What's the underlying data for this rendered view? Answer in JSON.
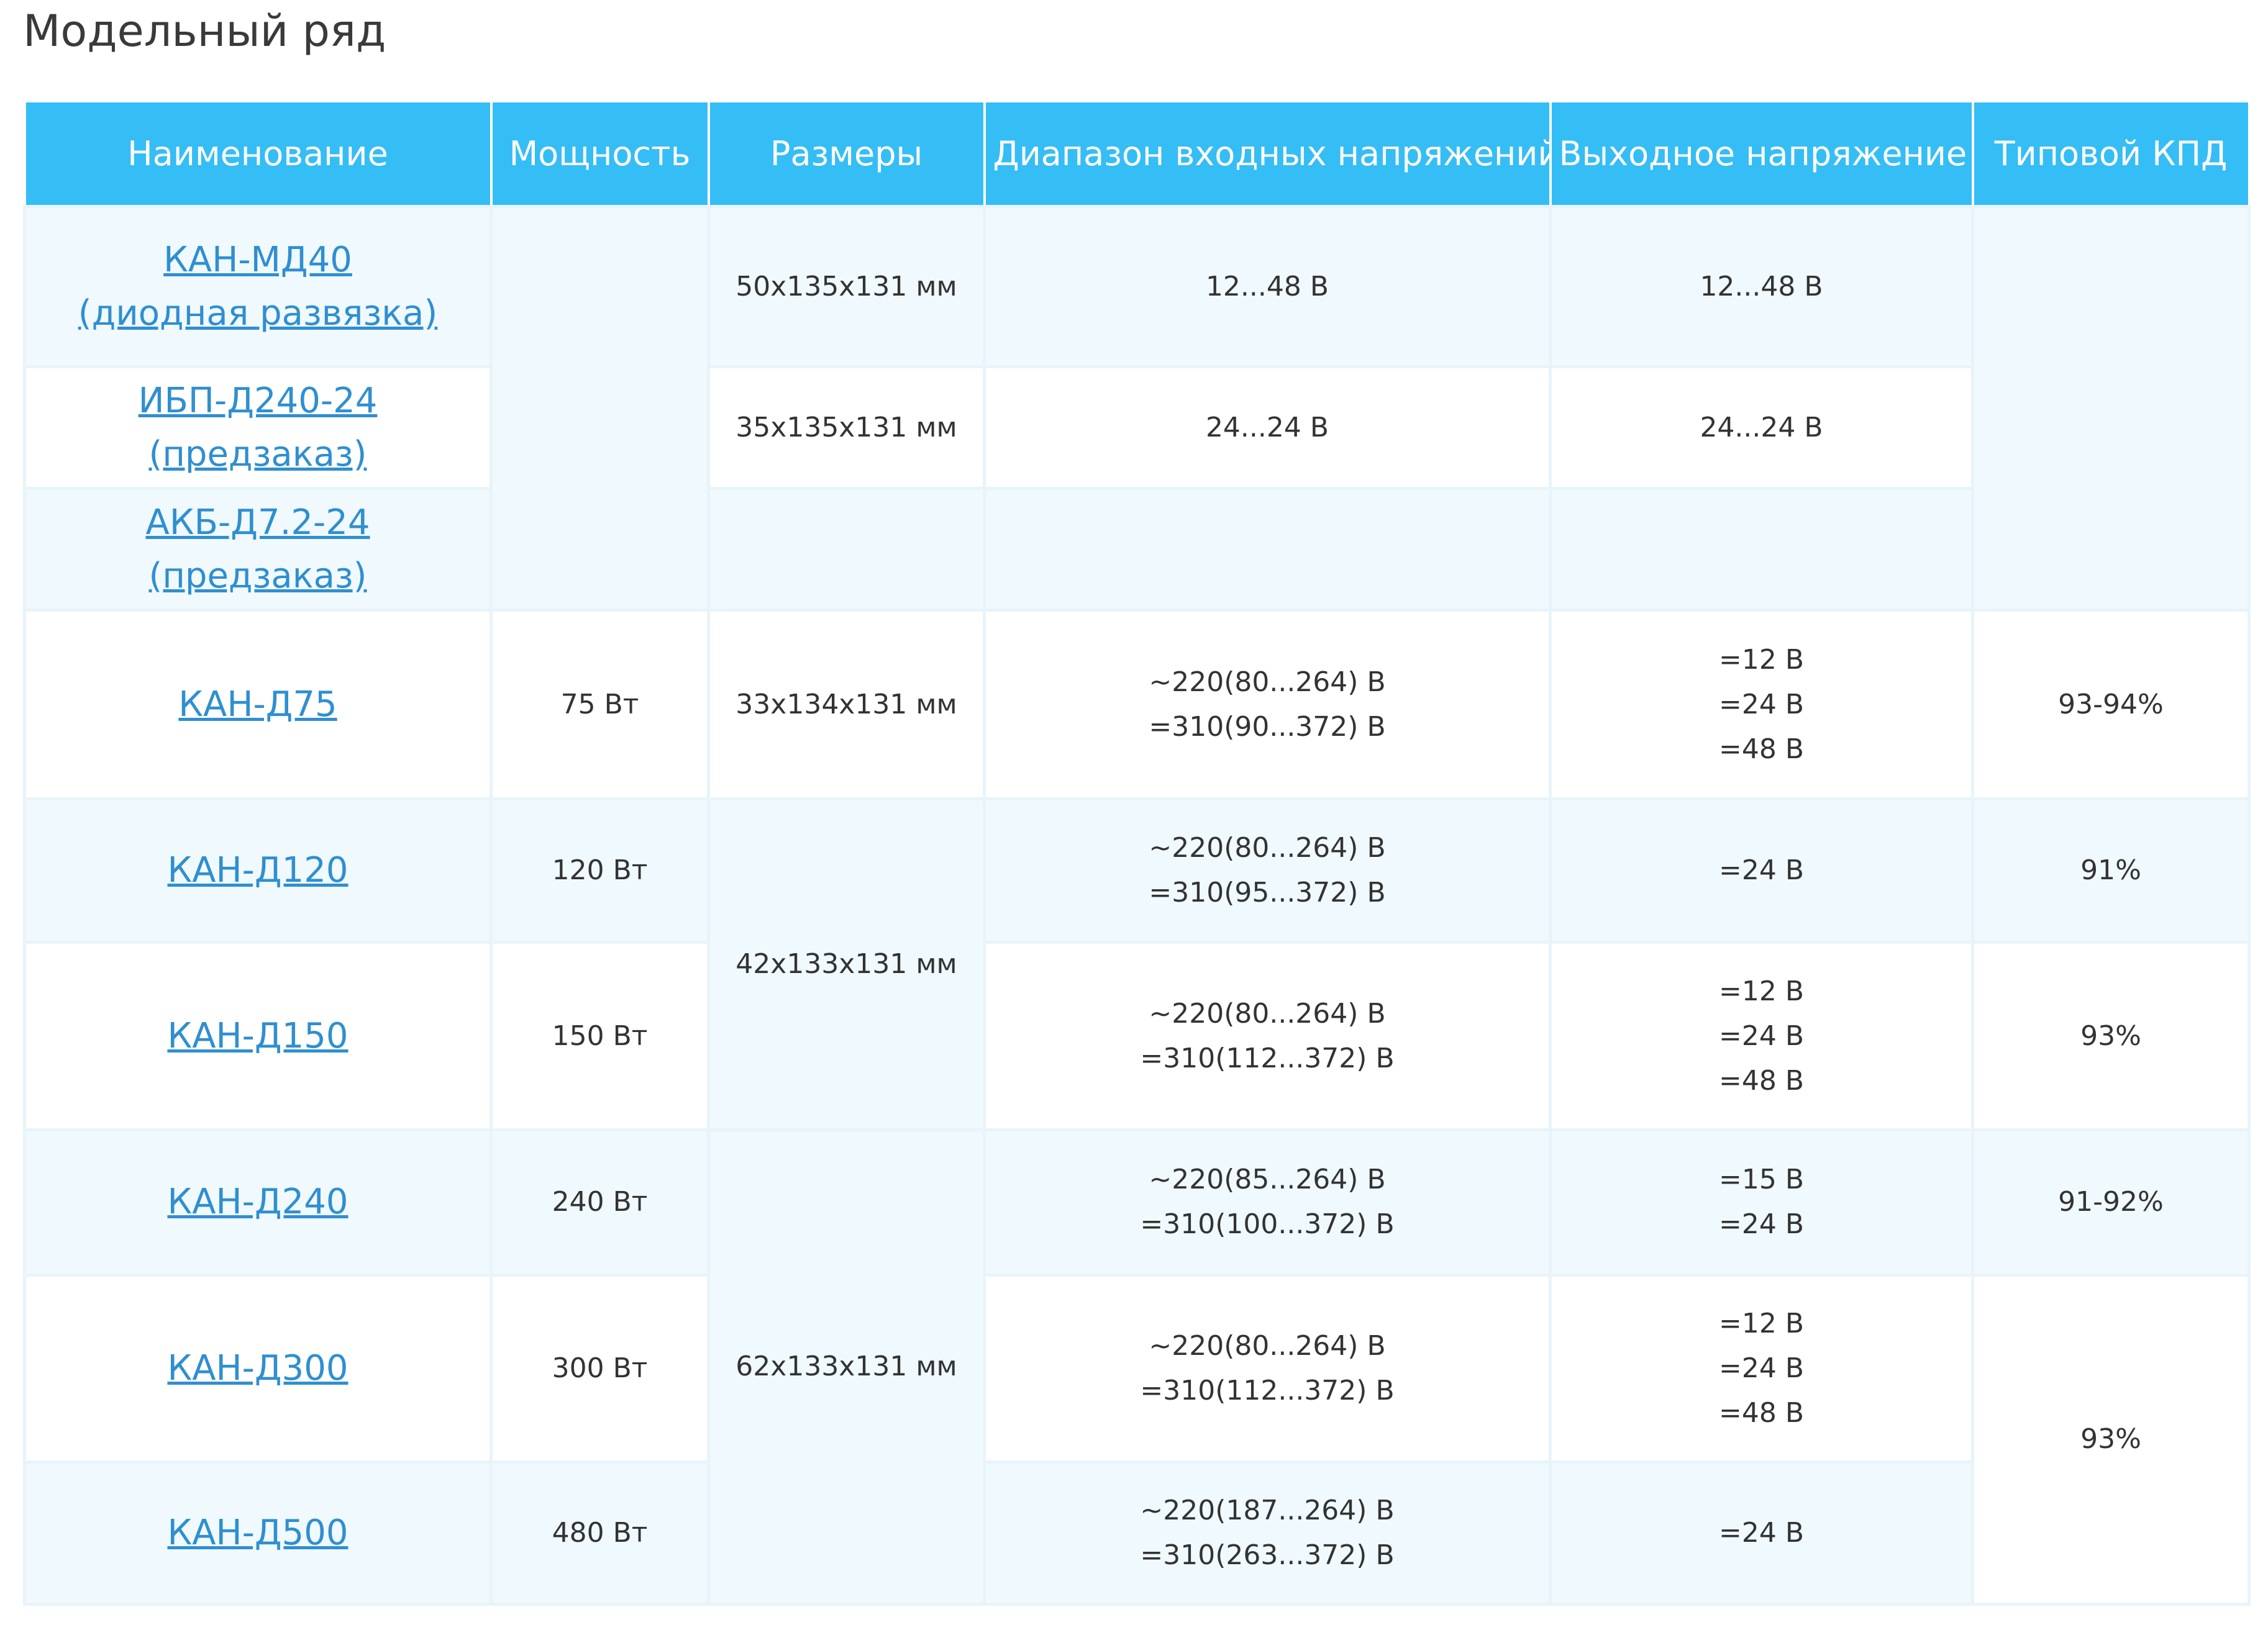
{
  "page_title": "Модельный ряд",
  "table": {
    "headers": {
      "name": "Наименование",
      "power": "Мощность",
      "size": "Размеры",
      "input": "Диапазон входных напряжений",
      "output": "Выходное напряжение",
      "efficiency": "Типовой КПД"
    },
    "rows": [
      {
        "name_line1": "КАН-МД40",
        "name_line2": "(диодная развязка)",
        "size": "50x135x131 мм",
        "input": "12...48 В",
        "output": "12...48 В"
      },
      {
        "name": "ИБП-Д240-24 (предзаказ)",
        "size": "35x135x131 мм",
        "input": "24...24 В",
        "output": "24...24 В"
      },
      {
        "name": "АКБ-Д7.2-24 (предзаказ)"
      },
      {
        "name": "КАН-Д75",
        "power": "75 Вт",
        "size": "33x134x131 мм",
        "input": [
          "~220(80...264) В",
          "=310(90...372) В"
        ],
        "output": [
          "=12 В",
          "=24 В",
          "=48 В"
        ],
        "efficiency": "93-94%"
      },
      {
        "name": "КАН-Д120",
        "power": "120 Вт",
        "size": "42x133x131 мм",
        "input": [
          "~220(80...264) В",
          "=310(95...372) В"
        ],
        "output": [
          "=24 В"
        ],
        "efficiency": "91%"
      },
      {
        "name": "КАН-Д150",
        "power": "150 Вт",
        "input": [
          "~220(80...264) В",
          "=310(112...372) В"
        ],
        "output": [
          "=12 В",
          "=24 В",
          "=48 В"
        ],
        "efficiency": "93%"
      },
      {
        "name": "КАН-Д240",
        "power": "240 Вт",
        "size": "62x133x131 мм",
        "input": [
          "~220(85...264) В",
          "=310(100...372) В"
        ],
        "output": [
          "=15 В",
          "=24 В"
        ],
        "efficiency": "91-92%"
      },
      {
        "name": "КАН-Д300",
        "power": "300 Вт",
        "input": [
          "~220(80...264) В",
          "=310(112...372) В"
        ],
        "output": [
          "=12 В",
          "=24 В",
          "=48 В"
        ],
        "efficiency": "93%"
      },
      {
        "name": "КАН-Д500",
        "power": "480 Вт",
        "input": [
          "~220(187...264) В",
          "=310(263...372) В"
        ],
        "output": [
          "=24 В"
        ]
      }
    ]
  }
}
